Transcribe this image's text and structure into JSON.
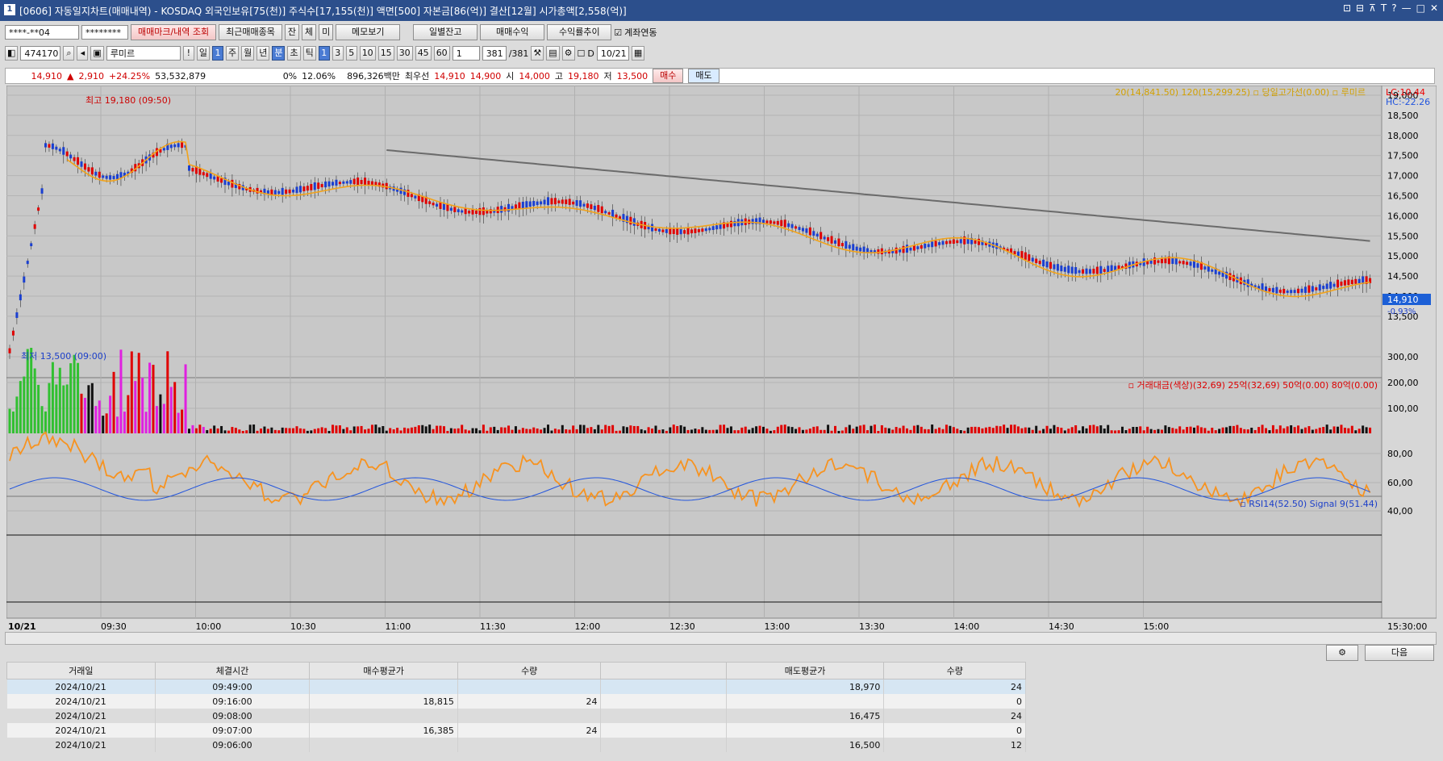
{
  "title": {
    "num": "1",
    "text": "[0606] 자동일지차트(매매내역) - KOSDAQ 외국인보유[75(천)] 주식수[17,155(천)] 액면[500] 자본금[86(억)] 결산[12월] 시가총액[2,558(억)]",
    "controls": [
      "⊡",
      "⊟",
      "⊼",
      "T",
      "?",
      "—",
      "□",
      "✕"
    ]
  },
  "toolbar1": {
    "account": "****-**04",
    "password": "********",
    "btn_marks": "매매마크/내역 조회",
    "btn_recent": "최근매매종목",
    "btn_jan": "잔",
    "btn_che": "체",
    "btn_mi": "미",
    "btn_memo": "메모보기",
    "btn_daily": "일별잔고",
    "btn_profit": "매매수익",
    "btn_rate": "수익률추이",
    "chk_link": "계좌연동"
  },
  "toolbar2": {
    "code": "474170",
    "name": "루미르",
    "period": [
      "일",
      "1",
      "주",
      "월",
      "년",
      "분",
      "초",
      "틱"
    ],
    "intervals": [
      "1",
      "3",
      "5",
      "10",
      "15",
      "30",
      "45",
      "60"
    ],
    "step": "1",
    "count": "381",
    "count_total": "/381",
    "chk_d": "D",
    "date": "10/21"
  },
  "quote": {
    "price": "14,910",
    "change": "2,910",
    "pct": "+24.25%",
    "volume": "53,532,879",
    "ratio1": "0%",
    "ratio2": "12.06%",
    "amount": "896,326백만",
    "best_label": "최우선",
    "ask": "14,910",
    "bid": "14,900",
    "open_label": "시",
    "open": "14,000",
    "high_label": "고",
    "high": "19,180",
    "low_label": "저",
    "low": "13,500",
    "buy": "매수",
    "sell": "매도"
  },
  "chart": {
    "legend_price": "20(14,841.50)  120(15,299.25)  ▫ 당일고가선(0.00) ▫ 루미르",
    "lc": "LC:10.44",
    "hc": "HC:-22.26",
    "max_label": "최고 19,180 (09:50)",
    "min_label": "최저 13,500 (09:00)",
    "price_box": "14,910",
    "price_pct": "-0.93%",
    "legend_volume": "▫ 거래대금(색상)(32,69)  25억(32,69)  50억(0.00)  80억(0.00)",
    "legend_rsi": "▫ RSI14(52.50)  Signal 9(51.44)",
    "date_label": "10/21",
    "close_label": "15:30:00",
    "price_ticks": [
      "19,000",
      "18,500",
      "18,000",
      "17,500",
      "17,000",
      "16,500",
      "16,000",
      "15,500",
      "15,000",
      "14,500",
      "14,000",
      "13,500"
    ],
    "vol_ticks": [
      "300,00",
      "200,00",
      "100,00"
    ],
    "rsi_ticks": [
      "80,00",
      "60,00",
      "40,00"
    ],
    "time_ticks": [
      "09:30",
      "10:00",
      "10:30",
      "11:00",
      "11:30",
      "12:00",
      "12:30",
      "13:00",
      "13:30",
      "14:00",
      "14:30",
      "15:00"
    ]
  },
  "bottom": {
    "next": "다음"
  },
  "table": {
    "headers": [
      "거래일",
      "체결시간",
      "매수평균가",
      "수량",
      "",
      "매도평균가",
      "수량"
    ],
    "rows": [
      [
        "2024/10/21",
        "09:49:00",
        "",
        "",
        "",
        "18,970",
        "24"
      ],
      [
        "2024/10/21",
        "09:16:00",
        "18,815",
        "24",
        "",
        "",
        "0"
      ],
      [
        "2024/10/21",
        "09:08:00",
        "",
        "",
        "",
        "16,475",
        "24"
      ],
      [
        "2024/10/21",
        "09:07:00",
        "16,385",
        "24",
        "",
        "",
        "0"
      ],
      [
        "2024/10/21",
        "09:06:00",
        "",
        "",
        "",
        "16,500",
        "12"
      ]
    ]
  }
}
